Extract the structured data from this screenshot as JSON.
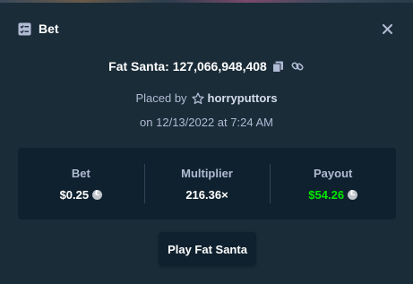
{
  "colors": {
    "background": "#1a2c38",
    "panel": "#0f212e",
    "text_muted": "#b1bad3",
    "payout_green": "#00e701"
  },
  "header": {
    "title": "Bet",
    "icon": "bet-slip-icon",
    "close_icon": "close-icon"
  },
  "game": {
    "label": "Fat Santa: 127,066,948,408",
    "copy_icon": "copy-icon",
    "link_icon": "link-icon"
  },
  "placed": {
    "prefix": "Placed by",
    "star_icon": "star-icon",
    "username": "horryputtors",
    "date": "on 12/13/2022 at 7:24 AM"
  },
  "stats": {
    "bet": {
      "label": "Bet",
      "value": "$0.25",
      "currency_icon": "litecoin-icon"
    },
    "multiplier": {
      "label": "Multiplier",
      "value": "216.36×"
    },
    "payout": {
      "label": "Payout",
      "value": "$54.26",
      "currency_icon": "litecoin-icon"
    }
  },
  "actions": {
    "play_label": "Play Fat Santa"
  }
}
